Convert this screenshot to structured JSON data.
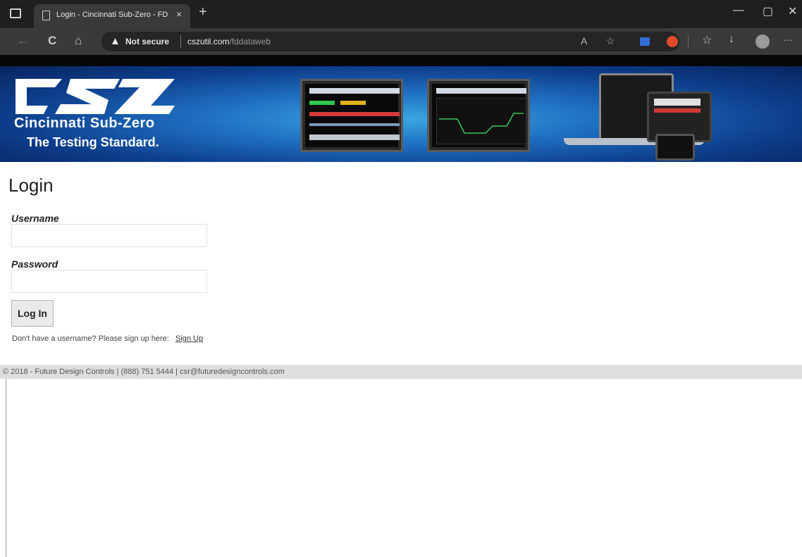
{
  "browser": {
    "tab_title": "Login - Cincinnati Sub-Zero - FD…",
    "tab_close": "×",
    "new_tab": "+",
    "minimize": "—",
    "restore": "▢",
    "close": "✕",
    "security_label": "Not secure",
    "url_host": "cszutil.com",
    "url_path": "/fddataweb",
    "more": "···"
  },
  "banner": {
    "logo_text": "CSZ",
    "brand": "Cincinnati Sub-Zero",
    "tagline": "The Testing Standard."
  },
  "page": {
    "title": "Login",
    "username_label": "Username",
    "password_label": "Password",
    "login_button": "Log In",
    "signup_prompt": "Don't have a username? Please sign up here:",
    "signup_link": "Sign Up"
  },
  "footer": {
    "text": "© 2018 - Future Design Controls | (888) 751 5444 | csr@futuredesigncontrols.com"
  },
  "icons": {
    "back": "←",
    "reload": "C",
    "home": "⌂",
    "warning": "▲",
    "read_aloud": "A",
    "favorite": "☆",
    "download": "↓"
  },
  "colors": {
    "banner_dark": "#08255e",
    "banner_light": "#3aa8e0",
    "footer_bg": "#dedede"
  }
}
